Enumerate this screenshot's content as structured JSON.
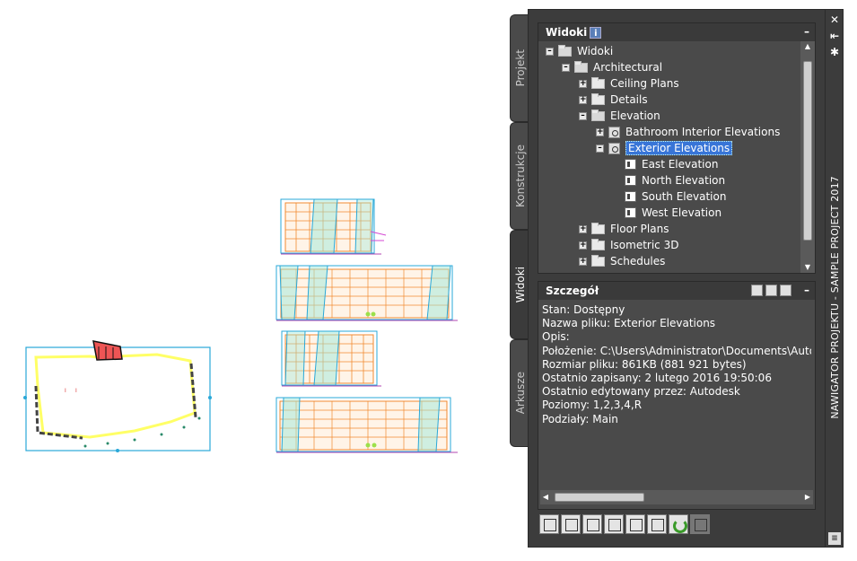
{
  "tabs": [
    {
      "label": "Projekt",
      "active": false
    },
    {
      "label": "Konstrukcje",
      "active": false
    },
    {
      "label": "Widoki",
      "active": true
    },
    {
      "label": "Arkusze",
      "active": false
    }
  ],
  "palette_title": "NAWIGATOR PROJEKTU - SAMPLE PROJECT 2017",
  "tree_panel": {
    "title": "Widoki",
    "info_icon": "i",
    "minimize": "–",
    "items": [
      {
        "label": "Widoki",
        "expander": "–",
        "icon": "folder-open-icon"
      },
      {
        "label": "Architectural",
        "expander": "–",
        "icon": "folder-open-icon"
      },
      {
        "label": "Ceiling Plans",
        "expander": "+",
        "icon": "folder-icon"
      },
      {
        "label": "Details",
        "expander": "+",
        "icon": "folder-icon"
      },
      {
        "label": "Elevation",
        "expander": "–",
        "icon": "folder-open-icon"
      },
      {
        "label": "Bathroom Interior Elevations",
        "expander": "+",
        "icon": "view-icon"
      },
      {
        "label": "Exterior Elevations",
        "expander": "–",
        "icon": "view-icon",
        "selected": true
      },
      {
        "label": "East Elevation",
        "icon": "elevation-icon"
      },
      {
        "label": "North Elevation",
        "icon": "elevation-icon"
      },
      {
        "label": "South Elevation",
        "icon": "elevation-icon"
      },
      {
        "label": "West Elevation",
        "icon": "elevation-icon"
      },
      {
        "label": "Floor Plans",
        "expander": "+",
        "icon": "folder-icon"
      },
      {
        "label": "Isometric 3D",
        "expander": "+",
        "icon": "folder-icon"
      },
      {
        "label": "Schedules",
        "expander": "+",
        "icon": "folder-icon"
      }
    ]
  },
  "detail_panel": {
    "title": "Szczegół",
    "minimize": "–",
    "lines": [
      "Stan: Dostępny",
      "Nazwa pliku: Exterior Elevations",
      "Opis:",
      "Położenie: C:\\Users\\Administrator\\Documents\\Autodesk",
      "Rozmiar pliku: 861KB (881 921 bytes)",
      "Ostatnio zapisany: 2 lutego 2016  19:50:06",
      "Ostatnio edytowany przez: Autodesk",
      "Poziomy: 1,2,3,4,R",
      "Podziały: Main"
    ]
  },
  "sidebar_buttons": {
    "close": "✕",
    "autohide": "⇤",
    "properties": "✱"
  },
  "toolbar_icons": [
    "new-view-icon",
    "add-view-icon",
    "regenerate-icon",
    "clipboard-icon",
    "edit-icon",
    "table-icon",
    "refresh-icon",
    "disabled-icon"
  ]
}
